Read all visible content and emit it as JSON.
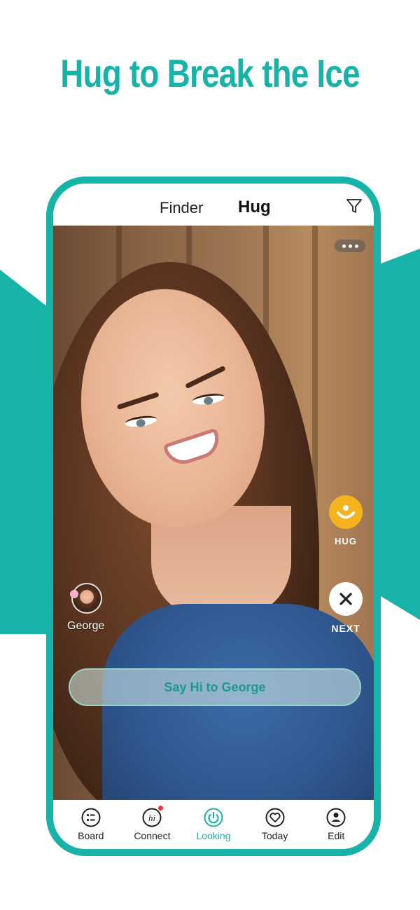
{
  "headline": "Hug to Break the Ice",
  "colors": {
    "accent": "#17b3a8",
    "hug": "#f5b31e",
    "badge": "#e53935"
  },
  "header": {
    "tabs": [
      {
        "label": "Finder",
        "active": false
      },
      {
        "label": "Hug",
        "active": true
      }
    ],
    "filter_icon": "filter-icon"
  },
  "card": {
    "more_icon": "more-options-icon",
    "actions": {
      "hug_label": "HUG",
      "next_label": "NEXT"
    },
    "profile": {
      "name": "George"
    },
    "say_hi_label": "Say Hi to George"
  },
  "nav": {
    "items": [
      {
        "label": "Board",
        "icon": "board-icon",
        "active": false
      },
      {
        "label": "Connect",
        "icon": "connect-hi-icon",
        "active": false,
        "badge": true
      },
      {
        "label": "Looking",
        "icon": "looking-power-icon",
        "active": true
      },
      {
        "label": "Today",
        "icon": "today-heart-icon",
        "active": false
      },
      {
        "label": "Edit",
        "icon": "edit-profile-icon",
        "active": false
      }
    ]
  }
}
